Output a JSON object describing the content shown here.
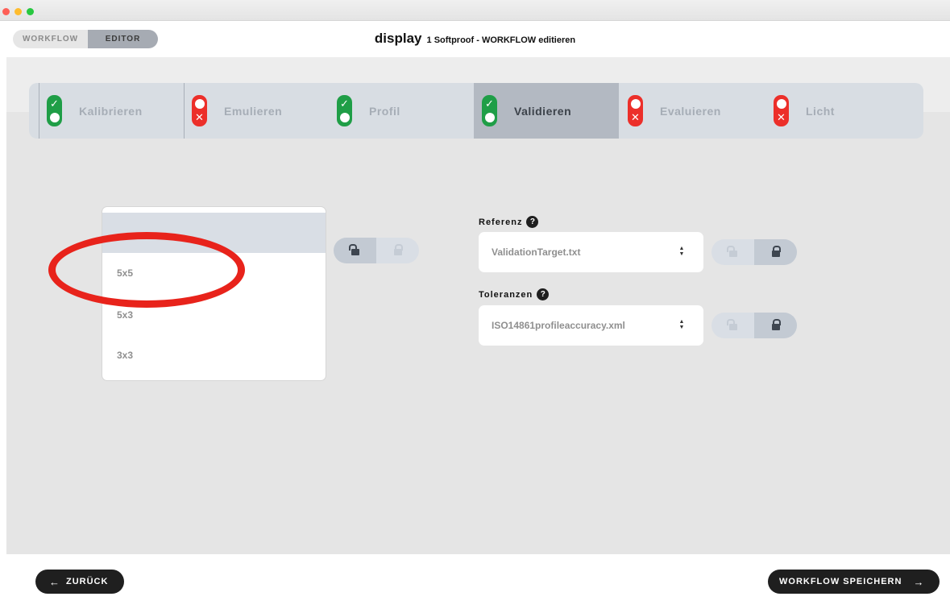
{
  "window": {
    "traffic_lights": [
      "close",
      "minimize",
      "zoom"
    ]
  },
  "header": {
    "mode_toggle": {
      "workflow_label": "WORKFLOW",
      "editor_label": "EDITOR",
      "active": "EDITOR"
    },
    "app_name": "display",
    "subtitle": "1 Softproof - WORKFLOW editieren"
  },
  "steps": [
    {
      "label": "Kalibrieren",
      "status": "ok",
      "active": false
    },
    {
      "label": "Emulieren",
      "status": "error",
      "active": false
    },
    {
      "label": "Profil",
      "status": "ok",
      "active": false
    },
    {
      "label": "Validieren",
      "status": "ok",
      "active": true
    },
    {
      "label": "Evaluieren",
      "status": "error",
      "active": false
    },
    {
      "label": "Licht",
      "status": "error",
      "active": false
    }
  ],
  "chart_list": {
    "items": [
      "",
      "5x5",
      "5x3",
      "3x3"
    ],
    "selected_index": 0
  },
  "referenz": {
    "label": "Referenz",
    "help": "?",
    "value": "ValidationTarget.txt",
    "locked": true
  },
  "toleranzen": {
    "label": "Toleranzen",
    "help": "?",
    "value": "ISO14861profileaccuracy.xml",
    "locked": true
  },
  "list_lock": {
    "locked": false
  },
  "footer": {
    "back_label": "ZURÜCK",
    "back_icon": "arrow-left-icon",
    "save_label": "WORKFLOW SPEICHERN",
    "save_icon": "arrow-right-icon"
  },
  "colors": {
    "ok": "#1f9e47",
    "error": "#ec2f2a",
    "annotation": "#e8231b",
    "step_bar": "#d8dde3",
    "step_active": "#b3b9c2"
  }
}
